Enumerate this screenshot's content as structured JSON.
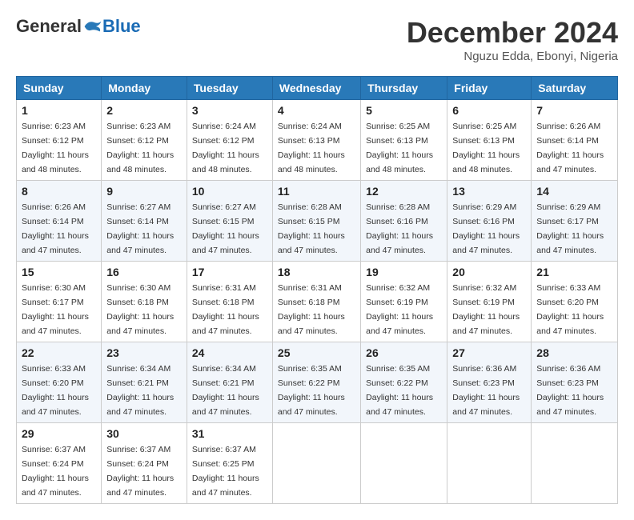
{
  "logo": {
    "general": "General",
    "blue": "Blue"
  },
  "header": {
    "month": "December 2024",
    "location": "Nguzu Edda, Ebonyi, Nigeria"
  },
  "weekdays": [
    "Sunday",
    "Monday",
    "Tuesday",
    "Wednesday",
    "Thursday",
    "Friday",
    "Saturday"
  ],
  "weeks": [
    [
      {
        "day": "1",
        "sunrise": "6:23 AM",
        "sunset": "6:12 PM",
        "daylight": "11 hours and 48 minutes."
      },
      {
        "day": "2",
        "sunrise": "6:23 AM",
        "sunset": "6:12 PM",
        "daylight": "11 hours and 48 minutes."
      },
      {
        "day": "3",
        "sunrise": "6:24 AM",
        "sunset": "6:12 PM",
        "daylight": "11 hours and 48 minutes."
      },
      {
        "day": "4",
        "sunrise": "6:24 AM",
        "sunset": "6:13 PM",
        "daylight": "11 hours and 48 minutes."
      },
      {
        "day": "5",
        "sunrise": "6:25 AM",
        "sunset": "6:13 PM",
        "daylight": "11 hours and 48 minutes."
      },
      {
        "day": "6",
        "sunrise": "6:25 AM",
        "sunset": "6:13 PM",
        "daylight": "11 hours and 48 minutes."
      },
      {
        "day": "7",
        "sunrise": "6:26 AM",
        "sunset": "6:14 PM",
        "daylight": "11 hours and 47 minutes."
      }
    ],
    [
      {
        "day": "8",
        "sunrise": "6:26 AM",
        "sunset": "6:14 PM",
        "daylight": "11 hours and 47 minutes."
      },
      {
        "day": "9",
        "sunrise": "6:27 AM",
        "sunset": "6:14 PM",
        "daylight": "11 hours and 47 minutes."
      },
      {
        "day": "10",
        "sunrise": "6:27 AM",
        "sunset": "6:15 PM",
        "daylight": "11 hours and 47 minutes."
      },
      {
        "day": "11",
        "sunrise": "6:28 AM",
        "sunset": "6:15 PM",
        "daylight": "11 hours and 47 minutes."
      },
      {
        "day": "12",
        "sunrise": "6:28 AM",
        "sunset": "6:16 PM",
        "daylight": "11 hours and 47 minutes."
      },
      {
        "day": "13",
        "sunrise": "6:29 AM",
        "sunset": "6:16 PM",
        "daylight": "11 hours and 47 minutes."
      },
      {
        "day": "14",
        "sunrise": "6:29 AM",
        "sunset": "6:17 PM",
        "daylight": "11 hours and 47 minutes."
      }
    ],
    [
      {
        "day": "15",
        "sunrise": "6:30 AM",
        "sunset": "6:17 PM",
        "daylight": "11 hours and 47 minutes."
      },
      {
        "day": "16",
        "sunrise": "6:30 AM",
        "sunset": "6:18 PM",
        "daylight": "11 hours and 47 minutes."
      },
      {
        "day": "17",
        "sunrise": "6:31 AM",
        "sunset": "6:18 PM",
        "daylight": "11 hours and 47 minutes."
      },
      {
        "day": "18",
        "sunrise": "6:31 AM",
        "sunset": "6:18 PM",
        "daylight": "11 hours and 47 minutes."
      },
      {
        "day": "19",
        "sunrise": "6:32 AM",
        "sunset": "6:19 PM",
        "daylight": "11 hours and 47 minutes."
      },
      {
        "day": "20",
        "sunrise": "6:32 AM",
        "sunset": "6:19 PM",
        "daylight": "11 hours and 47 minutes."
      },
      {
        "day": "21",
        "sunrise": "6:33 AM",
        "sunset": "6:20 PM",
        "daylight": "11 hours and 47 minutes."
      }
    ],
    [
      {
        "day": "22",
        "sunrise": "6:33 AM",
        "sunset": "6:20 PM",
        "daylight": "11 hours and 47 minutes."
      },
      {
        "day": "23",
        "sunrise": "6:34 AM",
        "sunset": "6:21 PM",
        "daylight": "11 hours and 47 minutes."
      },
      {
        "day": "24",
        "sunrise": "6:34 AM",
        "sunset": "6:21 PM",
        "daylight": "11 hours and 47 minutes."
      },
      {
        "day": "25",
        "sunrise": "6:35 AM",
        "sunset": "6:22 PM",
        "daylight": "11 hours and 47 minutes."
      },
      {
        "day": "26",
        "sunrise": "6:35 AM",
        "sunset": "6:22 PM",
        "daylight": "11 hours and 47 minutes."
      },
      {
        "day": "27",
        "sunrise": "6:36 AM",
        "sunset": "6:23 PM",
        "daylight": "11 hours and 47 minutes."
      },
      {
        "day": "28",
        "sunrise": "6:36 AM",
        "sunset": "6:23 PM",
        "daylight": "11 hours and 47 minutes."
      }
    ],
    [
      {
        "day": "29",
        "sunrise": "6:37 AM",
        "sunset": "6:24 PM",
        "daylight": "11 hours and 47 minutes."
      },
      {
        "day": "30",
        "sunrise": "6:37 AM",
        "sunset": "6:24 PM",
        "daylight": "11 hours and 47 minutes."
      },
      {
        "day": "31",
        "sunrise": "6:37 AM",
        "sunset": "6:25 PM",
        "daylight": "11 hours and 47 minutes."
      },
      null,
      null,
      null,
      null
    ]
  ],
  "labels": {
    "sunrise": "Sunrise:",
    "sunset": "Sunset:",
    "daylight": "Daylight:"
  }
}
